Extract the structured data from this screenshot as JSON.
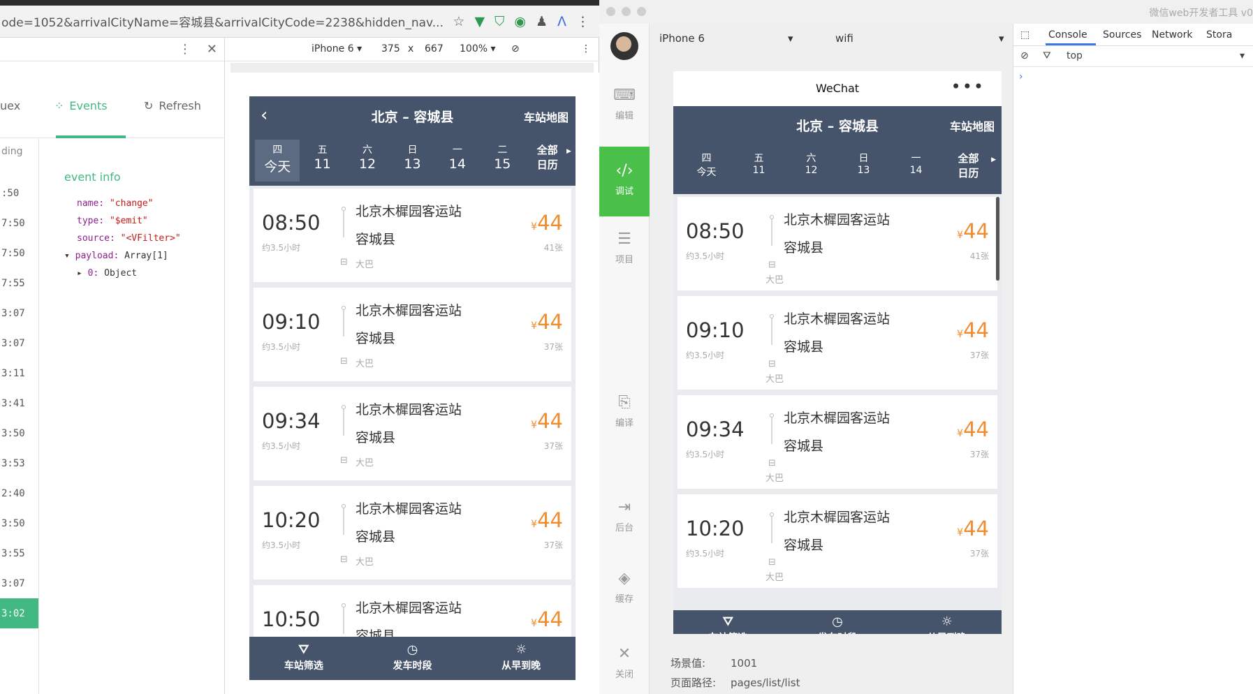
{
  "browser": {
    "url": "ode=1052&arrivalCityName=容城县&arrivalCityCode=2238&hidden_nav...",
    "extension_icons": [
      "star-icon",
      "vue-icon",
      "shield-icon",
      "puzzle-icon",
      "person-icon",
      "a-icon",
      "more-icon"
    ]
  },
  "vue_devtools": {
    "tabs": [
      {
        "label": "uex",
        "icon": ""
      },
      {
        "label": "Events",
        "icon": "events-icon"
      },
      {
        "label": "Refresh",
        "icon": "refresh-icon"
      }
    ],
    "list_header": "ding",
    "event_times": [
      ":50",
      "7:50",
      "7:50",
      "7:55",
      "3:07",
      "3:07",
      "3:11",
      "3:41",
      "3:50",
      "3:53",
      "2:40",
      "3:50",
      "3:55",
      "3:07",
      "3:02"
    ],
    "selected_index": 14,
    "event_info": {
      "title": "event info",
      "name_key": "name:",
      "name_val": "\"change\"",
      "type_key": "type:",
      "type_val": "\"$emit\"",
      "source_key": "source:",
      "source_val": "\"<VFilter>\"",
      "payload_key": "payload:",
      "payload_val": "Array[1]",
      "item_key": "0:",
      "item_val": "Object"
    }
  },
  "device_toolbar": {
    "device": "iPhone 6 ▾",
    "width": "375",
    "x": "x",
    "height": "667",
    "zoom": "100% ▾"
  },
  "bus_app": {
    "title": "北京 – 容城县",
    "map_button": "车站地图",
    "dates": [
      {
        "week": "四",
        "day": "今天",
        "active": true
      },
      {
        "week": "五",
        "day": "11"
      },
      {
        "week": "六",
        "day": "12"
      },
      {
        "week": "日",
        "day": "13"
      },
      {
        "week": "一",
        "day": "14"
      },
      {
        "week": "二",
        "day": "15"
      }
    ],
    "calendar_top": "全部",
    "calendar_bottom": "日历",
    "trips": [
      {
        "time": "08:50",
        "duration": "约3.5小时",
        "from": "北京木樨园客运站",
        "to": "容城县",
        "bus": "大巴",
        "price": "44",
        "currency": "¥",
        "tickets": "41张"
      },
      {
        "time": "09:10",
        "duration": "约3.5小时",
        "from": "北京木樨园客运站",
        "to": "容城县",
        "bus": "大巴",
        "price": "44",
        "currency": "¥",
        "tickets": "37张"
      },
      {
        "time": "09:34",
        "duration": "约3.5小时",
        "from": "北京木樨园客运站",
        "to": "容城县",
        "bus": "大巴",
        "price": "44",
        "currency": "¥",
        "tickets": "37张"
      },
      {
        "time": "10:20",
        "duration": "约3.5小时",
        "from": "北京木樨园客运站",
        "to": "容城县",
        "bus": "大巴",
        "price": "44",
        "currency": "¥",
        "tickets": "37张"
      },
      {
        "time": "10:50",
        "duration": "",
        "from": "北京木樨园客运站",
        "to": "容城县",
        "bus": "",
        "price": "44",
        "currency": "¥",
        "tickets": ""
      }
    ],
    "tabbar": [
      {
        "label": "车站筛选",
        "icon": "filter-icon"
      },
      {
        "label": "发车时段",
        "icon": "clock-icon"
      },
      {
        "label": "从早到晚",
        "icon": "sun-icon"
      }
    ]
  },
  "wechat_tool": {
    "window_title": "微信web开发者工具 v0",
    "sidebar": [
      {
        "label": "编辑",
        "icon": "code-icon"
      },
      {
        "label": "调试",
        "icon": "debug-icon",
        "active": true
      },
      {
        "label": "项目",
        "icon": "menu-icon"
      },
      {
        "label": "编译",
        "icon": "compile-icon"
      },
      {
        "label": "后台",
        "icon": "background-icon"
      },
      {
        "label": "缓存",
        "icon": "cache-icon"
      },
      {
        "label": "关闭",
        "icon": "close-icon"
      }
    ],
    "simulator": {
      "device": "iPhone 6",
      "network": "wifi",
      "nav_title": "WeChat",
      "capsule": "•••",
      "scene_label": "场景值:",
      "scene_value": "1001",
      "path_label": "页面路径:",
      "path_value": "pages/list/list"
    },
    "console_tabs": [
      "Console",
      "Sources",
      "Network",
      "Stora"
    ],
    "console_context": "top",
    "console_prompt": "›"
  },
  "colors": {
    "nav_bg": "#46546b",
    "price": "#f08c2e",
    "vue_green": "#42b983",
    "wechat_green": "#4ac04a"
  }
}
